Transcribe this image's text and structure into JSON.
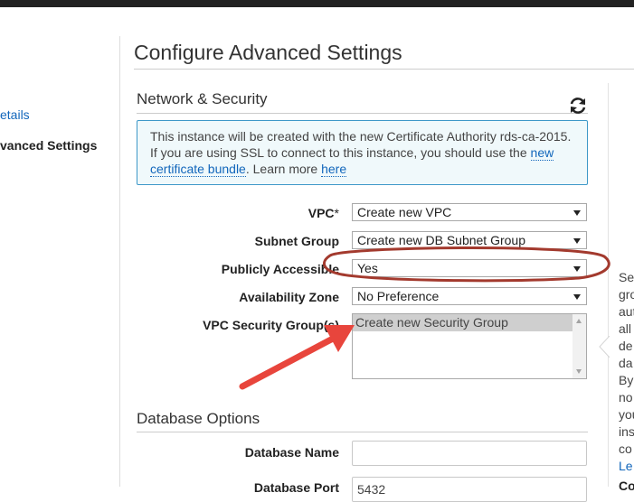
{
  "sidebar": {
    "link_fragment": "etails",
    "active_fragment": "vanced Settings"
  },
  "page": {
    "title": "Configure Advanced Settings"
  },
  "network_security": {
    "title": "Network & Security",
    "info": {
      "text_1": "This instance will be created with the new Certificate Authority rds-ca-2015. If you are using SSL to connect to this instance, you should use the ",
      "link_1": "new certificate bundle",
      "text_2": ". Learn more ",
      "link_2": "here"
    },
    "fields": {
      "vpc": {
        "label": "VPC",
        "required_mark": "*",
        "value": "Create new VPC"
      },
      "subnet_group": {
        "label": "Subnet Group",
        "value": "Create new DB Subnet Group"
      },
      "publicly_accessible": {
        "label": "Publicly Accessible",
        "value": "Yes"
      },
      "availability_zone": {
        "label": "Availability Zone",
        "value": "No Preference"
      },
      "vpc_security_groups": {
        "label": "VPC Security Group(s)",
        "options": [
          "Create new Security Group"
        ]
      }
    }
  },
  "help_panel": {
    "lines": [
      "Se",
      "gro",
      "aut",
      "all",
      "de",
      "da",
      "By",
      "no",
      "you",
      "ins",
      "co"
    ],
    "link_fragment": "Le"
  },
  "database_options": {
    "title": "Database Options",
    "fields": {
      "database_name": {
        "label": "Database Name",
        "value": ""
      },
      "database_port": {
        "label": "Database Port",
        "value": "5432"
      }
    },
    "bottom_fragment": "Co"
  },
  "colors": {
    "link": "#1166bb",
    "info_border": "#3d98c8",
    "annotation_oval": "#a33a2e",
    "annotation_arrow": "#e8453c"
  },
  "icons": [
    "refresh-icon",
    "dropdown-arrow-icon",
    "annotation-arrow"
  ]
}
